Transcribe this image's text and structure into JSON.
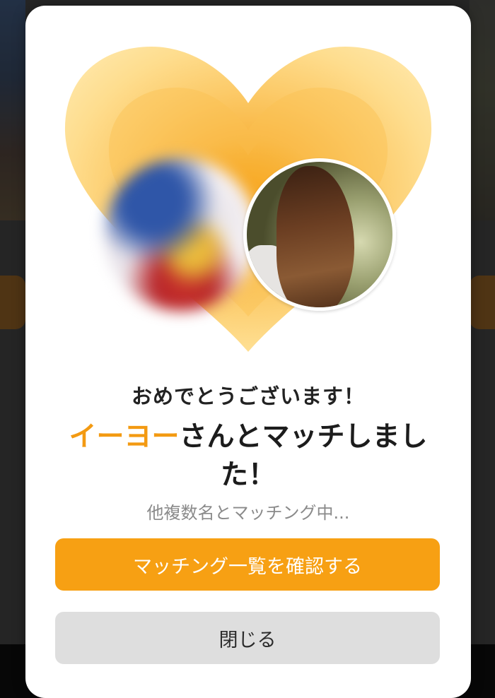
{
  "modal": {
    "congrats_text": "おめでとうございます！",
    "match_name": "イーヨー",
    "match_suffix": "さんとマッチしました！",
    "subtitle": "他複数名とマッチング中...",
    "primary_button_label": "マッチング一覧を確認する",
    "close_button_label": "閉じる"
  },
  "colors": {
    "accent": "#f7a013",
    "name_highlight": "#f39a12",
    "secondary_button": "#dedede",
    "heart_outer": "#ffe08a",
    "heart_inner": "#f5a524"
  },
  "icons": {
    "hero": "heart-icon"
  }
}
